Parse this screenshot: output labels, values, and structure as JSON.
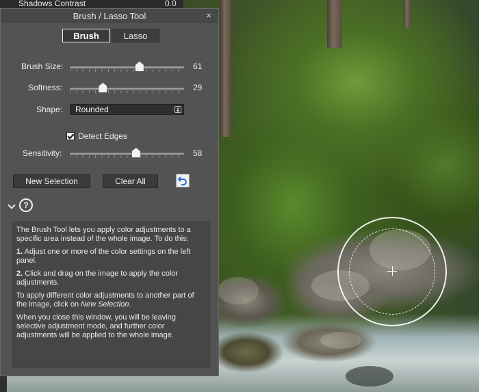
{
  "background_header": {
    "label": "Shadows Contrast",
    "value": "0.0"
  },
  "panel": {
    "title": "Brush / Lasso Tool",
    "close_glyph": "×",
    "tabs": [
      {
        "label": "Brush",
        "active": true
      },
      {
        "label": "Lasso",
        "active": false
      }
    ],
    "brush_size": {
      "label": "Brush Size:",
      "value": "61",
      "fraction": 0.61
    },
    "softness": {
      "label": "Softness:",
      "value": "29",
      "fraction": 0.29
    },
    "shape": {
      "label": "Shape:",
      "selected": "Rounded"
    },
    "detect_edges": {
      "label": "Detect Edges",
      "checked": true
    },
    "sensitivity": {
      "label": "Sensitivity:",
      "value": "58",
      "fraction": 0.58
    },
    "buttons": {
      "new_selection": "New Selection",
      "clear_all": "Clear All"
    },
    "help": {
      "intro": "The Brush Tool lets you apply color adjustments to a specific area instead of the whole image. To do this:",
      "step1_num": "1.",
      "step1": "Adjust one or more of the color settings on the left panel.",
      "step2_num": "2.",
      "step2": "Click and drag on the image to apply the color adjustments.",
      "different_a": "To apply different color adjustments to another part of the image, click on ",
      "different_link": "New Selection",
      "different_end": ".",
      "closing": "When you close this window, you will be leaving selective adjustment mode, and further color adjustments will be applied to the whole image."
    }
  },
  "icons": [
    "close-icon",
    "dropdown-arrows-icon",
    "checkmark-icon",
    "undo-icon",
    "chevron-down-icon",
    "help-icon",
    "brush-cursor-icon"
  ],
  "colors": {
    "panel_bg": "#535353",
    "helpbox_bg": "#464646",
    "undo_arrow": "#1f6fd6"
  }
}
